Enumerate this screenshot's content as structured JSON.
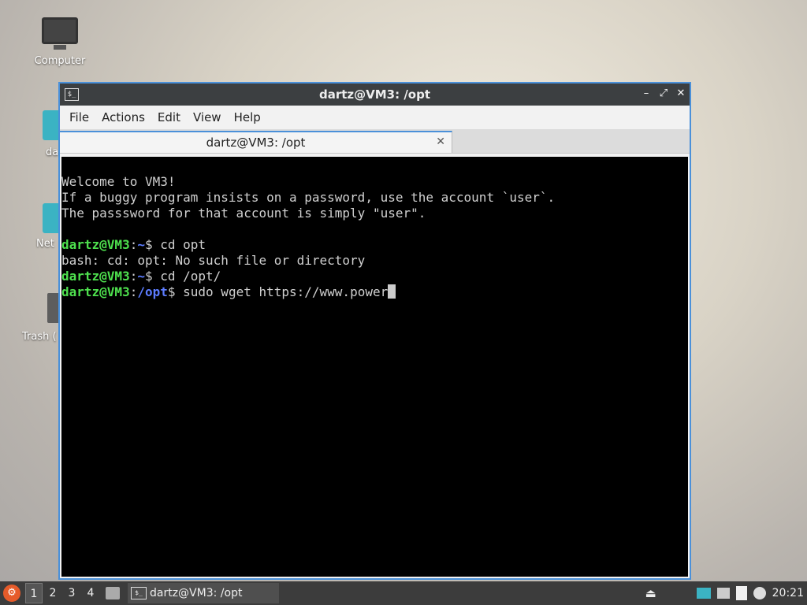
{
  "desktop": {
    "icons": [
      {
        "label": "Computer"
      },
      {
        "label": "da"
      },
      {
        "label": "Net"
      },
      {
        "label": "Trash ("
      }
    ]
  },
  "window": {
    "title": "dartz@VM3: /opt",
    "app_icon_text": "$_",
    "controls": {
      "minimize": "–",
      "maximize": "⤢",
      "close": "✕"
    },
    "menu": [
      "File",
      "Actions",
      "Edit",
      "View",
      "Help"
    ],
    "tab": {
      "label": "dartz@VM3: /opt",
      "close": "✕"
    }
  },
  "terminal": {
    "lines": [
      "Welcome to VM3!",
      "If a buggy program insists on a password, use the account `user`.",
      "The passsword for that account is simply \"user\".",
      ""
    ],
    "prompt_user": "dartz@VM3",
    "sessions": [
      {
        "path": "~",
        "command": "cd opt"
      },
      {
        "output": "bash: cd: opt: No such file or directory"
      },
      {
        "path": "~",
        "command": "cd /opt/"
      },
      {
        "path": "/opt",
        "command": "sudo wget https://www.power"
      }
    ]
  },
  "taskbar": {
    "start_icon": "⚙",
    "workspaces": [
      "1",
      "2",
      "3",
      "4"
    ],
    "active_workspace": "1",
    "task_label": "dartz@VM3: /opt",
    "task_icon_text": "$_",
    "eject_icon": "⏏",
    "clock": "20:21"
  },
  "colors": {
    "accent": "#4a90d9",
    "prompt_user": "#4ee04e",
    "prompt_path": "#5c7cff"
  }
}
